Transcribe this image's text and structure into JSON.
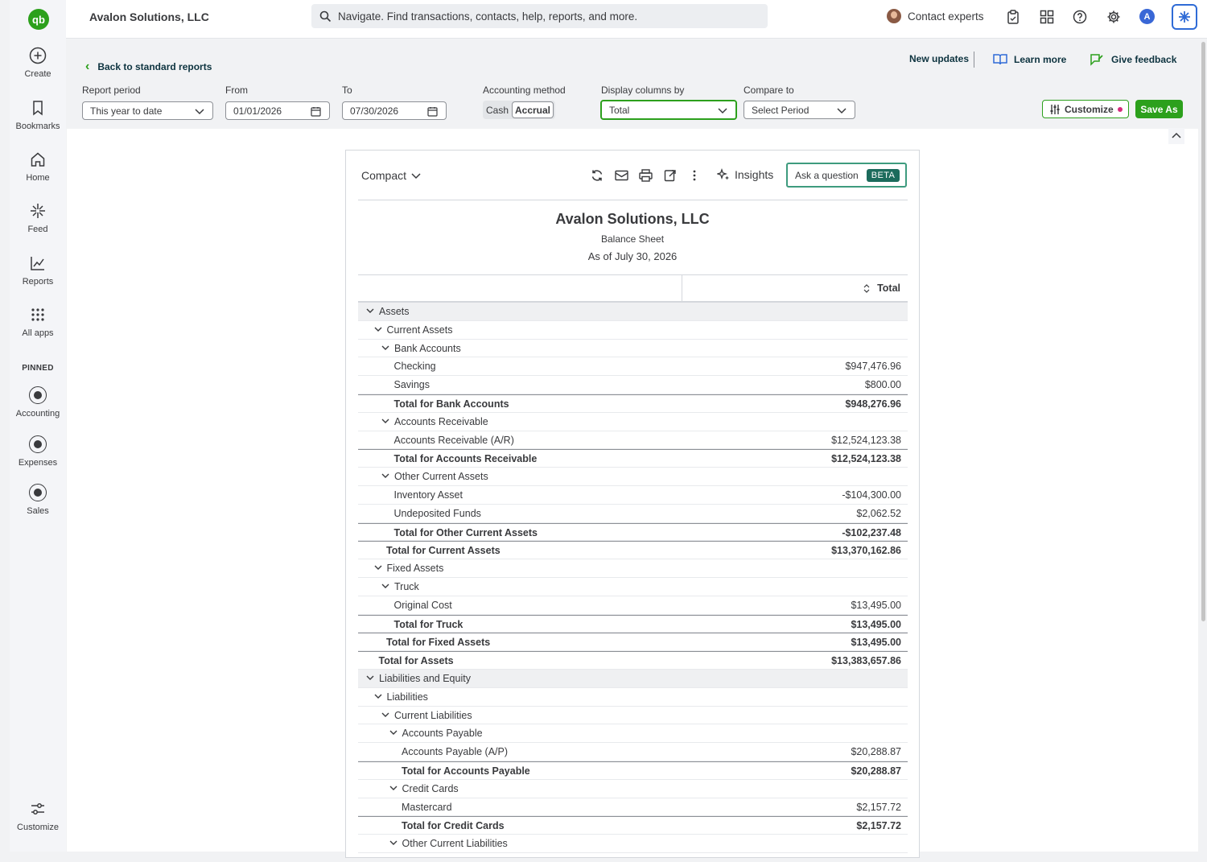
{
  "app": {
    "logo_text": "qb",
    "company": "Avalon Solutions, LLC"
  },
  "topbar": {
    "search_placeholder": "Navigate. Find transactions, contacts, help, reports, and more.",
    "contact_experts": "Contact experts",
    "user_initial": "A"
  },
  "sidebar": {
    "items": [
      {
        "label": "Create"
      },
      {
        "label": "Bookmarks"
      },
      {
        "label": "Home"
      },
      {
        "label": "Feed"
      },
      {
        "label": "Reports"
      },
      {
        "label": "All apps"
      }
    ],
    "pinned_title": "PINNED",
    "pinned": [
      {
        "label": "Accounting"
      },
      {
        "label": "Expenses"
      },
      {
        "label": "Sales"
      }
    ],
    "customize": "Customize"
  },
  "header": {
    "back": "Back to standard reports",
    "new_updates": "New updates",
    "learn_more": "Learn more",
    "give_feedback": "Give feedback"
  },
  "filters": {
    "report_period_label": "Report period",
    "report_period": "This year to date",
    "from_label": "From",
    "from": "01/01/2026",
    "to_label": "To",
    "to": "07/30/2026",
    "method_label": "Accounting method",
    "method_cash": "Cash",
    "method_accrual": "Accrual",
    "display_label": "Display columns by",
    "display": "Total",
    "compare_label": "Compare to",
    "compare": "Select Period",
    "customize": "Customize",
    "save_as": "Save As"
  },
  "report_toolbar": {
    "view": "Compact",
    "insights": "Insights",
    "ask": "Ask a question",
    "beta": "BETA"
  },
  "report": {
    "company": "Avalon Solutions, LLC",
    "title": "Balance Sheet",
    "date": "As of July 30, 2026",
    "column": "Total",
    "rows": [
      {
        "label": "Assets",
        "amount": "",
        "level": 0,
        "type": "section"
      },
      {
        "label": "Current Assets",
        "amount": "",
        "level": 1,
        "type": "group"
      },
      {
        "label": "Bank Accounts",
        "amount": "",
        "level": 2,
        "type": "group"
      },
      {
        "label": "Checking",
        "amount": "$947,476.96",
        "level": 3,
        "type": "line"
      },
      {
        "label": "Savings",
        "amount": "$800.00",
        "level": 3,
        "type": "line"
      },
      {
        "label": "Total for Bank Accounts",
        "amount": "$948,276.96",
        "level": 3,
        "type": "total"
      },
      {
        "label": "Accounts Receivable",
        "amount": "",
        "level": 2,
        "type": "group"
      },
      {
        "label": "Accounts Receivable (A/R)",
        "amount": "$12,524,123.38",
        "level": 3,
        "type": "line"
      },
      {
        "label": "Total for Accounts Receivable",
        "amount": "$12,524,123.38",
        "level": 3,
        "type": "total"
      },
      {
        "label": "Other Current Assets",
        "amount": "",
        "level": 2,
        "type": "group"
      },
      {
        "label": "Inventory Asset",
        "amount": "-$104,300.00",
        "level": 3,
        "type": "line"
      },
      {
        "label": "Undeposited Funds",
        "amount": "$2,062.52",
        "level": 3,
        "type": "line"
      },
      {
        "label": "Total for Other Current Assets",
        "amount": "-$102,237.48",
        "level": 3,
        "type": "total"
      },
      {
        "label": "Total for Current Assets",
        "amount": "$13,370,162.86",
        "level": 2,
        "type": "total"
      },
      {
        "label": "Fixed Assets",
        "amount": "",
        "level": 1,
        "type": "group"
      },
      {
        "label": "Truck",
        "amount": "",
        "level": 2,
        "type": "group"
      },
      {
        "label": "Original Cost",
        "amount": "$13,495.00",
        "level": 3,
        "type": "line"
      },
      {
        "label": "Total for Truck",
        "amount": "$13,495.00",
        "level": 3,
        "type": "total"
      },
      {
        "label": "Total for Fixed Assets",
        "amount": "$13,495.00",
        "level": 2,
        "type": "total"
      },
      {
        "label": "Total for Assets",
        "amount": "$13,383,657.86",
        "level": 1,
        "type": "total"
      },
      {
        "label": "Liabilities and Equity",
        "amount": "",
        "level": 0,
        "type": "section"
      },
      {
        "label": "Liabilities",
        "amount": "",
        "level": 1,
        "type": "group"
      },
      {
        "label": "Current Liabilities",
        "amount": "",
        "level": 2,
        "type": "group"
      },
      {
        "label": "Accounts Payable",
        "amount": "",
        "level": 3,
        "type": "group"
      },
      {
        "label": "Accounts Payable (A/P)",
        "amount": "$20,288.87",
        "level": 4,
        "type": "line"
      },
      {
        "label": "Total for Accounts Payable",
        "amount": "$20,288.87",
        "level": 4,
        "type": "total"
      },
      {
        "label": "Credit Cards",
        "amount": "",
        "level": 3,
        "type": "group"
      },
      {
        "label": "Mastercard",
        "amount": "$2,157.72",
        "level": 4,
        "type": "line"
      },
      {
        "label": "Total for Credit Cards",
        "amount": "$2,157.72",
        "level": 4,
        "type": "total"
      },
      {
        "label": "Other Current Liabilities",
        "amount": "",
        "level": 3,
        "type": "group"
      }
    ]
  }
}
